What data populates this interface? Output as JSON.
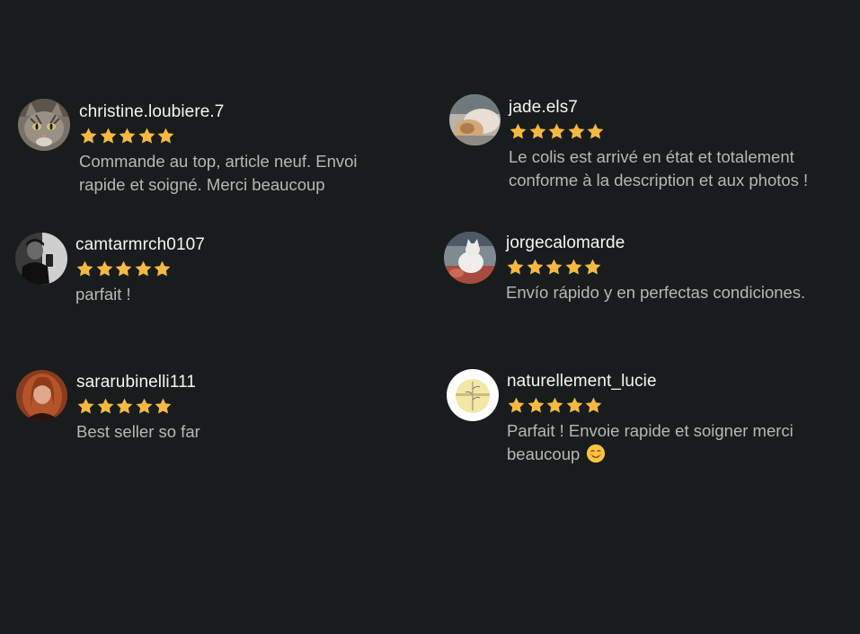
{
  "colors": {
    "background": "#191c1c",
    "username": "#f4f4f4",
    "review_text": "#b7b7b7",
    "star": "#f5b942"
  },
  "reviews": [
    {
      "username": "christine.loubiere.7",
      "rating": 5,
      "avatar": "cat-avatar",
      "text_lines": [
        "Commande au top, article neuf. Envoi",
        "rapide et soigné. Merci beaucoup"
      ]
    },
    {
      "username": "jade.els7",
      "rating": 5,
      "avatar": "photo-avatar",
      "text_lines": [
        "Le colis est arrivé en état et totalement",
        "conforme à la description et aux photos !"
      ]
    },
    {
      "username": "camtarmrch0107",
      "rating": 5,
      "avatar": "person-mono-avatar",
      "text_lines": [
        "parfait !"
      ]
    },
    {
      "username": "jorgecalomarde",
      "rating": 5,
      "avatar": "cat-sofa-avatar",
      "text_lines": [
        "Envío rápido y en perfectas condiciones."
      ]
    },
    {
      "username": "sararubinelli111",
      "rating": 5,
      "avatar": "woman-avatar",
      "text_lines": [
        "Best seller so far"
      ]
    },
    {
      "username": "naturellement_lucie",
      "rating": 5,
      "avatar": "logo-avatar",
      "text_lines": [
        "Parfait ! Envoie rapide et soigner merci",
        "beaucoup"
      ],
      "trailing_emoji": "smiling-face-icon"
    }
  ]
}
